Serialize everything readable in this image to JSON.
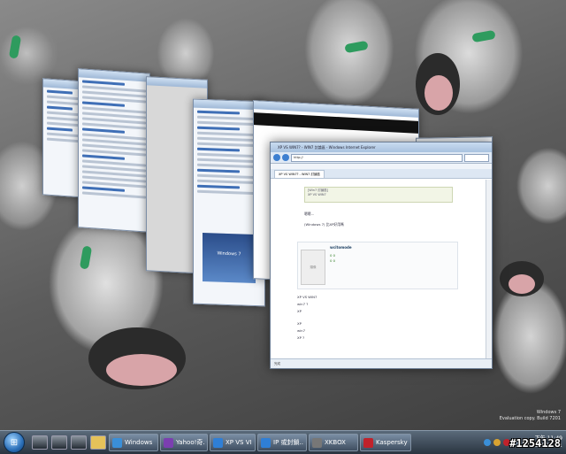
{
  "ie": {
    "title": "XP VS WIN7? - WIN7 討論區 - Windows Internet Explorer",
    "address": "http://",
    "tab_label": "XP VS WIN7? - WIN7 討論區",
    "notice_line1": "[Win7 討論區]",
    "notice_line2": "XP VS WIN7",
    "greeting": "嗯嗯...",
    "body_text": "(Windows 7) 比XP好用嗎",
    "post_username": "wcitomode",
    "post_meta1": "0 0",
    "post_meta2": "0 0",
    "avatar_label": "頭像",
    "post_body": [
      "XP VS WIN7",
      "win7 ?",
      "XP",
      "XP",
      "win7",
      "XP ?"
    ],
    "status_text": "完成"
  },
  "background_windows": {
    "banner_text": "Windows 7"
  },
  "watermark": {
    "line1": "Windows 7",
    "line2": "Evaluation copy. Build 7201"
  },
  "taskbar": {
    "start_icon": "windows-logo",
    "buttons": [
      {
        "label": "Windows ...",
        "icon_color": "#3a8fd8"
      },
      {
        "label": "Yahoo!奇...",
        "icon_color": "#7b3fb0"
      },
      {
        "label": "XP VS VIS...",
        "icon_color": "#2f7fd6"
      },
      {
        "label": "IP 或封鎖...",
        "icon_color": "#2f7fd6"
      },
      {
        "label": "XKBOX",
        "icon_color": "#777777"
      },
      {
        "label": "Kaspersky ...",
        "icon_color": "#c0222b"
      }
    ],
    "clock_time": "下午 11:49",
    "clock_date": "2009/5/11"
  },
  "overlay_number": "#1254128"
}
